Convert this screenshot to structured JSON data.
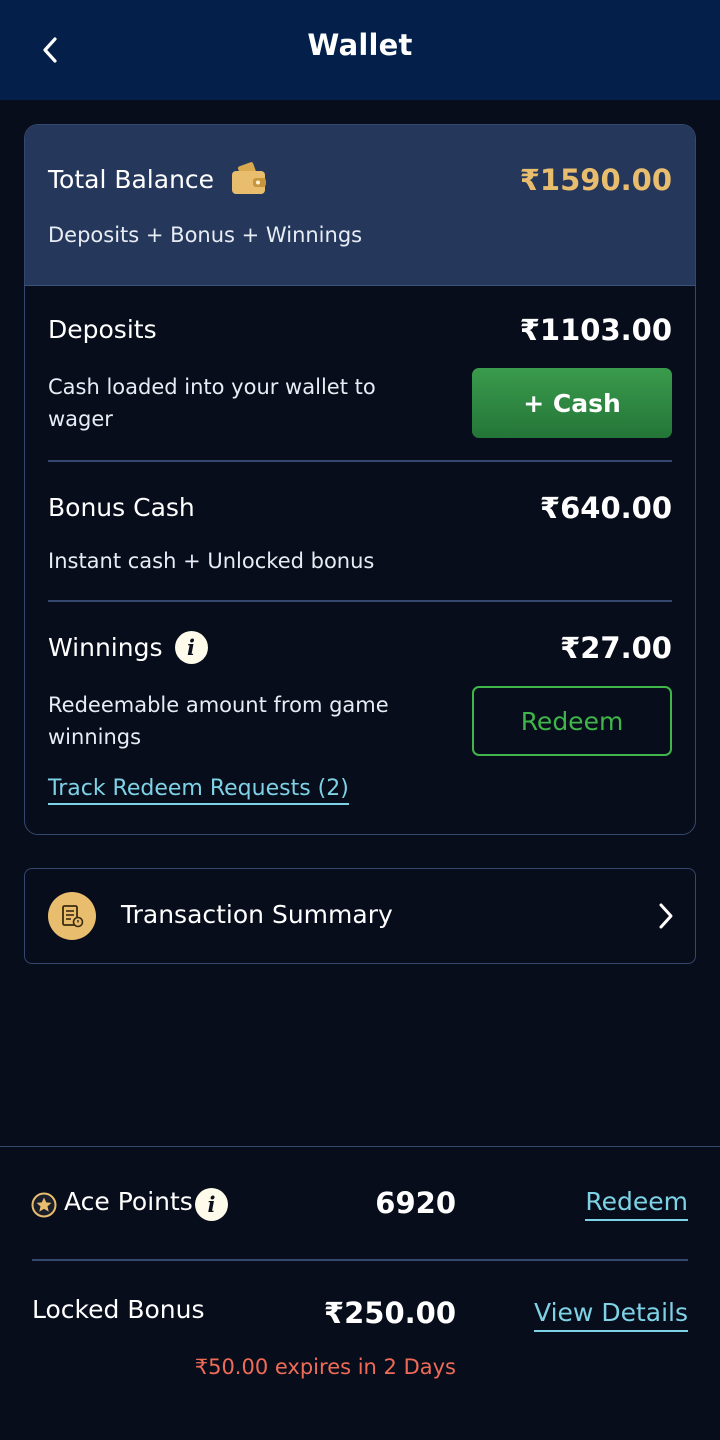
{
  "header": {
    "title": "Wallet",
    "back_icon": "chevron-left-icon"
  },
  "total_balance": {
    "label": "Total Balance",
    "icon": "wallet-icon",
    "amount": "₹1590.00",
    "subtitle": "Deposits + Bonus + Winnings",
    "amount_color": "#e9bd6e"
  },
  "deposits": {
    "label": "Deposits",
    "amount": "₹1103.00",
    "description": "Cash loaded into your wallet to wager",
    "button_label": "+ Cash"
  },
  "bonus_cash": {
    "label": "Bonus Cash",
    "amount": "₹640.00",
    "description": "Instant cash + Unlocked bonus"
  },
  "winnings": {
    "label": "Winnings",
    "amount": "₹27.00",
    "description": "Redeemable amount from game winnings",
    "button_label": "Redeem",
    "track_link": "Track Redeem Requests (2)"
  },
  "transaction_summary": {
    "label": "Transaction Summary",
    "icon": "receipt-icon"
  },
  "ace_points": {
    "label": "Ace Points",
    "value": "6920",
    "link": "Redeem",
    "icon": "star-badge-icon"
  },
  "locked_bonus": {
    "label": "Locked Bonus",
    "amount": "₹250.00",
    "link": "View Details",
    "expiry": "₹50.00 expires in 2 Days",
    "expiry_color": "#ef6b57"
  },
  "colors": {
    "accent_link": "#7ed2e6",
    "success": "#3fb54a",
    "header_bg": "#04204a",
    "page_bg": "#080d1b"
  }
}
